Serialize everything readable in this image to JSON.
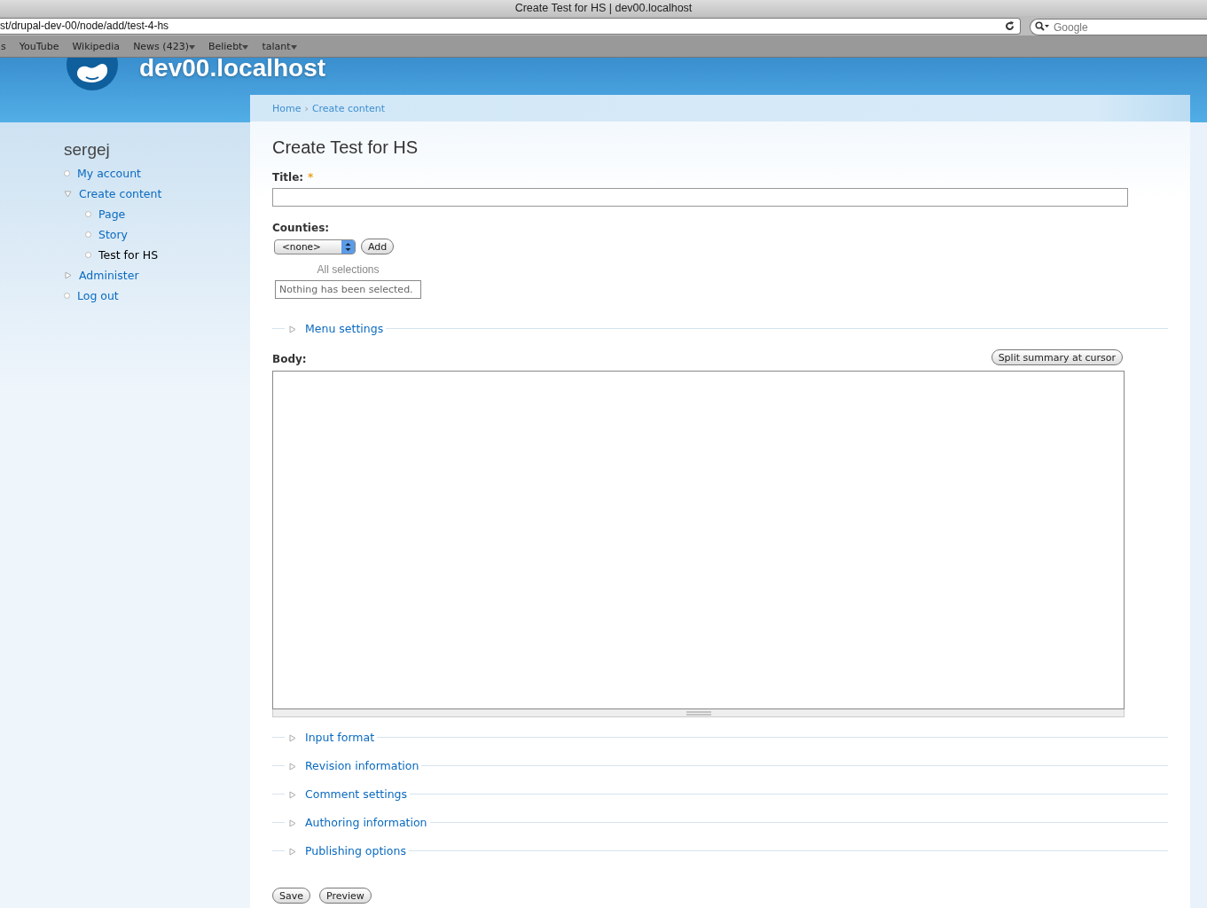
{
  "window": {
    "title": "Create Test for HS | dev00.localhost"
  },
  "browser": {
    "url": "st/drupal-dev-00/node/add/test-4-hs",
    "search_placeholder": "Google",
    "bookmarks": [
      {
        "label": "s",
        "has_menu": false
      },
      {
        "label": "YouTube",
        "has_menu": false
      },
      {
        "label": "Wikipedia",
        "has_menu": false
      },
      {
        "label": "News (423)",
        "has_menu": true
      },
      {
        "label": "Beliebt",
        "has_menu": true
      },
      {
        "label": "talant",
        "has_menu": true
      }
    ]
  },
  "site": {
    "name": "dev00.localhost"
  },
  "breadcrumb": [
    "Home",
    "Create content"
  ],
  "breadcrumb_separator": "›",
  "sidebar": {
    "user": "sergej",
    "items": [
      {
        "label": "My account",
        "kind": "leaf",
        "active": false
      },
      {
        "label": "Create content",
        "kind": "expanded",
        "active": false,
        "children": [
          {
            "label": "Page",
            "kind": "leaf",
            "active": false
          },
          {
            "label": "Story",
            "kind": "leaf",
            "active": false
          },
          {
            "label": "Test for HS",
            "kind": "leaf",
            "active": true
          }
        ]
      },
      {
        "label": "Administer",
        "kind": "collapsed",
        "active": false
      },
      {
        "label": "Log out",
        "kind": "leaf",
        "active": false
      }
    ]
  },
  "page_title": "Create Test for HS",
  "title_field": {
    "label": "Title:",
    "required": true,
    "required_marker": "*"
  },
  "counties": {
    "label": "Counties:",
    "value": "<none>",
    "add_button": "Add",
    "selections_heading": "All selections",
    "selections_empty": "Nothing has been selected."
  },
  "menu_settings": {
    "legend": "Menu settings",
    "collapsed": true
  },
  "body": {
    "label": "Body:",
    "split_button": "Split summary at cursor"
  },
  "fieldsets": [
    {
      "legend": "Input format",
      "collapsed": true
    },
    {
      "legend": "Revision information",
      "collapsed": true
    },
    {
      "legend": "Comment settings",
      "collapsed": true
    },
    {
      "legend": "Authoring information",
      "collapsed": true
    },
    {
      "legend": "Publishing options",
      "collapsed": true
    }
  ],
  "buttons": [
    "Save",
    "Preview"
  ]
}
